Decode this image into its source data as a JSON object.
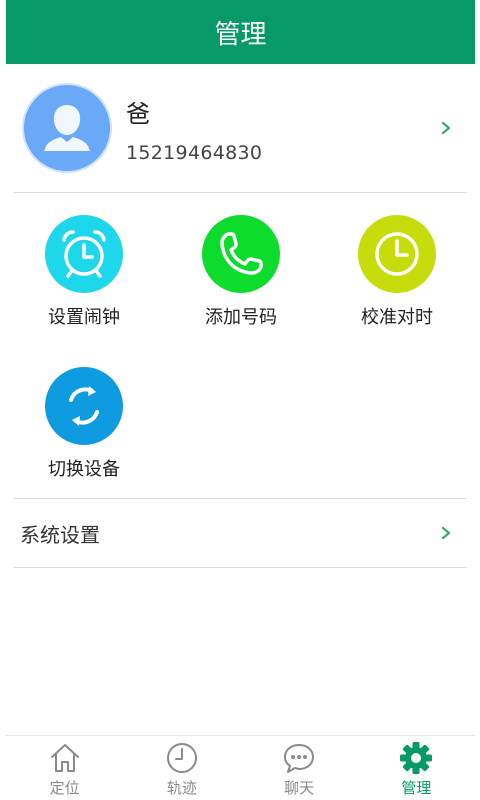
{
  "header": {
    "title": "管理"
  },
  "profile": {
    "name": "爸",
    "phone": "15219464830"
  },
  "features": [
    {
      "label": "设置闹钟",
      "icon": "alarm-clock-icon",
      "color": "#1fd7ea"
    },
    {
      "label": "添加号码",
      "icon": "phone-icon",
      "color": "#0ddc2d"
    },
    {
      "label": "校准对时",
      "icon": "clock-icon",
      "color": "#c6dc0b"
    },
    {
      "label": "切换设备",
      "icon": "switch-device-icon",
      "color": "#0f9be0"
    }
  ],
  "settings": {
    "label": "系统设置"
  },
  "nav": [
    {
      "label": "定位",
      "icon": "home-icon",
      "active": false
    },
    {
      "label": "轨迹",
      "icon": "clock-icon",
      "active": false
    },
    {
      "label": "聊天",
      "icon": "chat-icon",
      "active": false
    },
    {
      "label": "管理",
      "icon": "gear-icon",
      "active": true
    }
  ],
  "colors": {
    "brand": "#079a68",
    "chevron": "#3aa86a",
    "inactive": "#8a8a8a"
  }
}
